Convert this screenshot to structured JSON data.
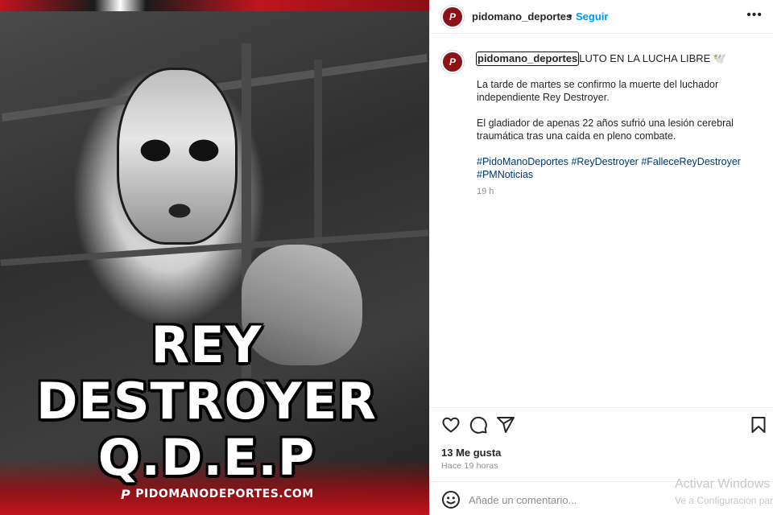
{
  "post": {
    "image": {
      "overlay_line1": "REY",
      "overlay_line2": "DESTROYER",
      "overlay_line3": "Q.D.E.P",
      "footer_brand": "PIDOMANODEPORTES.COM",
      "footer_logo": "P"
    },
    "header": {
      "username": "pidomano_deportes",
      "separator": "•",
      "follow_label": "Seguir",
      "more_icon": "more-horizontal-icon",
      "more_label": "•••"
    },
    "caption": {
      "username": "pidomano_deportes",
      "title": "LUTO EN LA LUCHA LIBRE 🕊️",
      "paragraph1": "La tarde de martes se confirmo la muerte del luchador independiente Rey Destroyer.",
      "paragraph2": "El gladiador de apenas 22 años sufrió una lesión cerebral traumática tras una caída en pleno combate.",
      "hashtags": [
        "#PidoManoDeportes",
        "#ReyDestroyer",
        "#FalleceReyDestroyer",
        "#PMNoticias"
      ],
      "time_ago": "19 h"
    },
    "actions": {
      "like_icon": "heart-icon",
      "comment_icon": "comment-icon",
      "share_icon": "send-icon",
      "save_icon": "bookmark-icon"
    },
    "likes_text": "13 Me gusta",
    "posted_text": "Hace 19 horas",
    "comment": {
      "emoji_icon": "smiley-icon",
      "placeholder": "Añade un comentario..."
    },
    "avatar_initials": "P"
  },
  "os_watermark": {
    "title": "Activar Windows",
    "subtitle": "Ve a Configuración para..."
  },
  "colors": {
    "brand_red": "#c0141e",
    "link_blue": "#0095f6",
    "hashtag_blue": "#00376b",
    "muted_gray": "#8e8e8e"
  }
}
